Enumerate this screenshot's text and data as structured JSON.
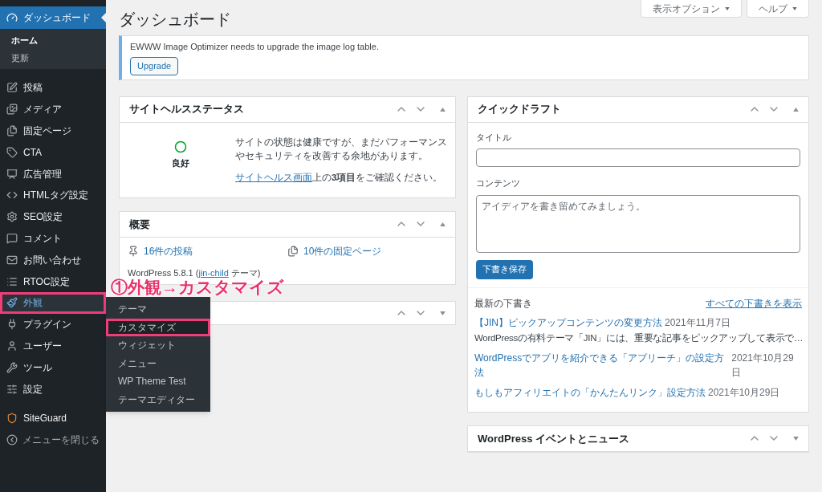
{
  "sidebar": {
    "current": {
      "label": "ダッシュボード",
      "children": [
        {
          "label": "ホーム",
          "selected": true
        },
        {
          "label": "更新",
          "selected": false
        }
      ]
    },
    "items": [
      {
        "label": "投稿",
        "hovered": false,
        "highlighted": false
      },
      {
        "label": "メディア",
        "hovered": false,
        "highlighted": false
      },
      {
        "label": "固定ページ",
        "hovered": false,
        "highlighted": false
      },
      {
        "label": "CTA",
        "hovered": false,
        "highlighted": false
      },
      {
        "label": "広告管理",
        "hovered": false,
        "highlighted": false
      },
      {
        "label": "HTMLタグ設定",
        "hovered": false,
        "highlighted": false
      },
      {
        "label": "SEO設定",
        "hovered": false,
        "highlighted": false
      },
      {
        "label": "コメント",
        "hovered": false,
        "highlighted": false
      },
      {
        "label": "お問い合わせ",
        "hovered": false,
        "highlighted": false
      },
      {
        "label": "RTOC設定",
        "hovered": false,
        "highlighted": false
      },
      {
        "label": "外観",
        "hovered": true,
        "highlighted": true,
        "flyout": [
          {
            "label": "テーマ",
            "highlighted": false
          },
          {
            "label": "カスタマイズ",
            "highlighted": true
          },
          {
            "label": "ウィジェット",
            "highlighted": false
          },
          {
            "label": "メニュー",
            "highlighted": false
          },
          {
            "label": "WP Theme Test",
            "highlighted": false
          },
          {
            "label": "テーマエディター",
            "highlighted": false
          }
        ]
      },
      {
        "label": "プラグイン",
        "hovered": false,
        "highlighted": false
      },
      {
        "label": "ユーザー",
        "hovered": false,
        "highlighted": false
      },
      {
        "label": "ツール",
        "hovered": false,
        "highlighted": false
      },
      {
        "label": "設定",
        "hovered": false,
        "highlighted": false
      }
    ],
    "plugin_items": [
      {
        "label": "SiteGuard"
      }
    ],
    "collapse_label": "メニューを閉じる"
  },
  "header": {
    "title": "ダッシュボード",
    "screen_options": "表示オプション",
    "help": "ヘルプ"
  },
  "notice": {
    "text": "EWWW Image Optimizer needs to upgrade the image log table.",
    "button": "Upgrade"
  },
  "site_health": {
    "title": "サイトヘルスステータス",
    "expanded": true,
    "status": "良好",
    "message": "サイトの状態は健康ですが、まだパフォーマンスやセキュリティを改善する余地があります。",
    "link": "サイトヘルス画面",
    "action": "上の**3項目**をご確認ください。"
  },
  "overview": {
    "title": "概要",
    "expanded": true,
    "stats": [
      {
        "label": "16件の投稿"
      },
      {
        "label": "10件の固定ページ"
      }
    ],
    "version_before": "WordPress 5.8.1 (",
    "theme": "jin-child",
    "version_after": " テーマ)"
  },
  "hidden_panel": {
    "expanded": false
  },
  "quick_draft": {
    "title": "クイックドラフト",
    "expanded": true,
    "title_label": "タイトル",
    "content_label": "コンテンツ",
    "content_placeholder": "アイディアを書き留めてみましょう。",
    "save": "下書き保存",
    "drafts_heading": "最新の下書き",
    "view_all": "すべての下書きを表示",
    "drafts": [
      {
        "title": "【JIN】ピックアップコンテンツの変更方法",
        "date": "2021年11月7日",
        "excerpt": "WordPressの有料テーマ「JIN」には、重要な記事をピックアップして表示で…"
      },
      {
        "title": "WordPressでアプリを紹介できる「アプリーチ」の設定方法",
        "date": "2021年10月29日"
      },
      {
        "title": "もしもアフィリエイトの「かんたんリンク」設定方法",
        "date": "2021年10月29日"
      }
    ]
  },
  "events": {
    "title": "WordPress イベントとニュース",
    "expanded": false
  },
  "annotation": {
    "text": "①外観→カスタマイズ"
  }
}
